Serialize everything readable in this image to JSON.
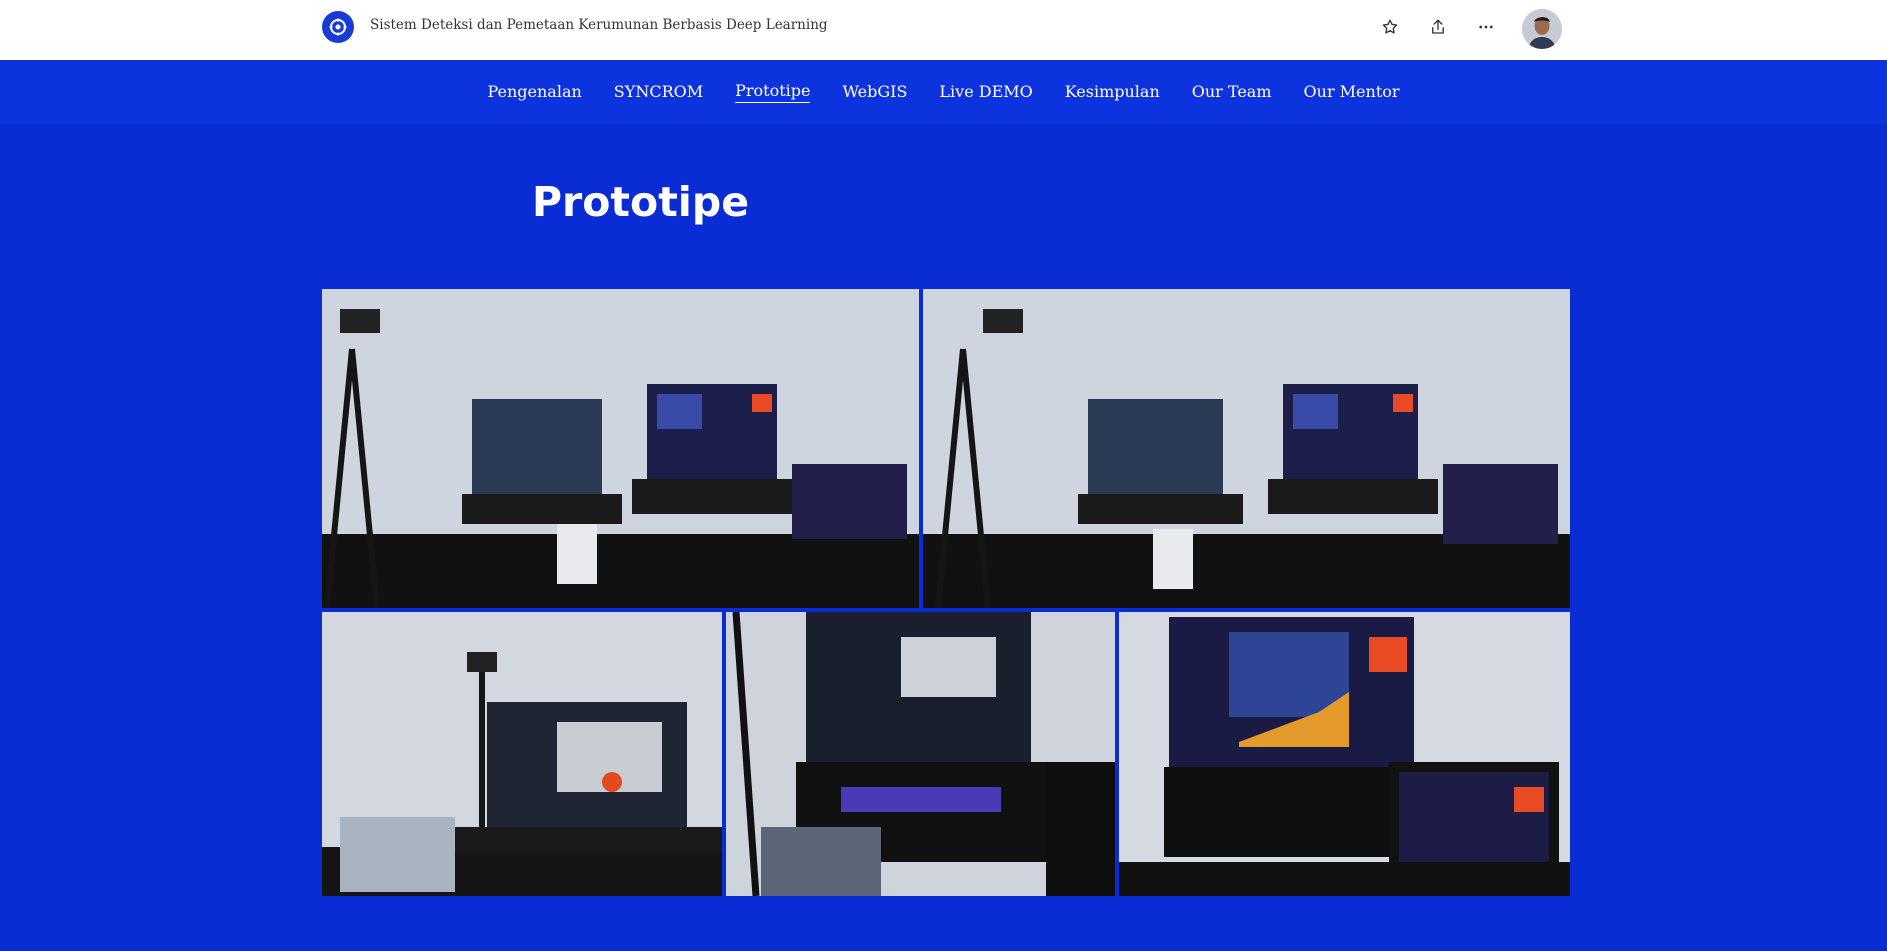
{
  "header": {
    "site_title": "Sistem Deteksi dan Pemetaan Kerumunan Berbasis Deep Learning",
    "logo_icon": "gear-logo-icon",
    "actions": [
      {
        "icon": "star-icon"
      },
      {
        "icon": "share-icon"
      },
      {
        "icon": "more-icon"
      }
    ],
    "avatar": "user-avatar"
  },
  "nav": {
    "items": [
      {
        "label": "Pengenalan"
      },
      {
        "label": "SYNCROM"
      },
      {
        "label": "Prototipe",
        "active": true
      },
      {
        "label": "WebGIS"
      },
      {
        "label": "Live DEMO"
      },
      {
        "label": "Kesimpulan"
      },
      {
        "label": "Our Team"
      },
      {
        "label": "Our Mentor"
      }
    ]
  },
  "main": {
    "heading": "Prototipe",
    "gallery": [
      {
        "subject": "tripod-camera-laptops-tablet"
      },
      {
        "subject": "tripod-camera-laptops-tablet-2"
      },
      {
        "subject": "edge-device-laptop-camera"
      },
      {
        "subject": "laptop-code-edge-device"
      },
      {
        "subject": "dashboard-laptop-tablet"
      }
    ]
  },
  "theme": {
    "page_bg": "#0a2cd4",
    "nav_bg": "#0d33de",
    "topbar_bg": "#ffffff",
    "accent": "#1a3ad6"
  }
}
